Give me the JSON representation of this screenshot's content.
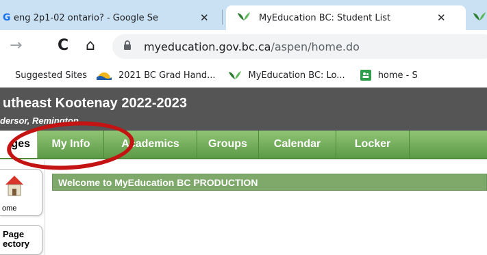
{
  "browser": {
    "tabs": [
      {
        "title": "eng 2p1-02 ontario? - Google Se",
        "icon": "google-g-icon"
      },
      {
        "title": "MyEducation BC: Student List",
        "icon": "myed-leaf-icon"
      },
      {
        "title": "",
        "icon": "myed-leaf-icon"
      }
    ],
    "tab_close_glyph": "✕",
    "nav_glyphs": {
      "back": "→",
      "reload": "C",
      "home": "⌂"
    },
    "url_host": "myeducation.gov.bc.ca",
    "url_path": "/aspen/home.do",
    "bookmarks": [
      {
        "label": "Suggested Sites",
        "icon": "none"
      },
      {
        "label": "2021 BC Grad Hand...",
        "icon": "bc-sun-icon"
      },
      {
        "label": "MyEducation BC: Lo...",
        "icon": "myed-leaf-icon"
      },
      {
        "label": "home - S",
        "icon": "home-green-icon"
      }
    ]
  },
  "app": {
    "org_title": "utheast Kootenay 2022-2023",
    "user_name": "dersor, Remington",
    "nav_tabs": [
      {
        "label": "ges",
        "active": true
      },
      {
        "label": "My Info",
        "active": false
      },
      {
        "label": "Academics",
        "active": false
      },
      {
        "label": "Groups",
        "active": false
      },
      {
        "label": "Calendar",
        "active": false
      },
      {
        "label": "Locker",
        "active": false
      }
    ],
    "side_nav": [
      {
        "label": "ome",
        "icon": "home-icon"
      },
      {
        "label_line1": "Page",
        "label_line2": "ectory"
      }
    ],
    "welcome_text": "Welcome to MyEducation BC PRODUCTION"
  },
  "colors": {
    "tabstrip_bg": "#c9e1f3",
    "header_bg": "#555555",
    "nav_green": "#6aa654",
    "welcome_bar": "#7ea96a",
    "annotation_red": "#c31313"
  }
}
